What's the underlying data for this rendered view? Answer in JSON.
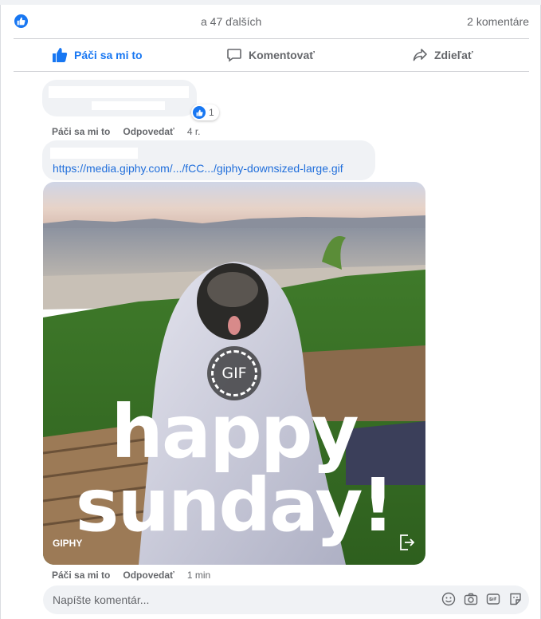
{
  "stats": {
    "others_text": "a 47 ďalších",
    "comments_text": "2 komentáre"
  },
  "actions": {
    "like_label": "Páči sa mi to",
    "comment_label": "Komentovať",
    "share_label": "Zdieľať"
  },
  "comments": [
    {
      "reaction_count": "1",
      "like_link": "Páči sa mi to",
      "reply_link": "Odpovedať",
      "time": "4 r."
    },
    {
      "link_text": "https://media.giphy.com/.../fCC.../giphy-downsized-large.gif",
      "gif": {
        "badge_text": "GIF",
        "caption_line1": "happy",
        "caption_line2": "sunday!",
        "brand": "GIPHY"
      },
      "like_link": "Páči sa mi to",
      "reply_link": "Odpovedať",
      "time": "1 min"
    }
  ],
  "composer": {
    "placeholder": "Napíšte komentár...",
    "icons": [
      "emoji-icon",
      "camera-icon",
      "gif-icon",
      "sticker-icon"
    ]
  },
  "colors": {
    "brand_blue": "#1877f2",
    "link_blue": "#216fdb",
    "muted_text": "#65676b",
    "bubble_bg": "#f0f2f5"
  }
}
